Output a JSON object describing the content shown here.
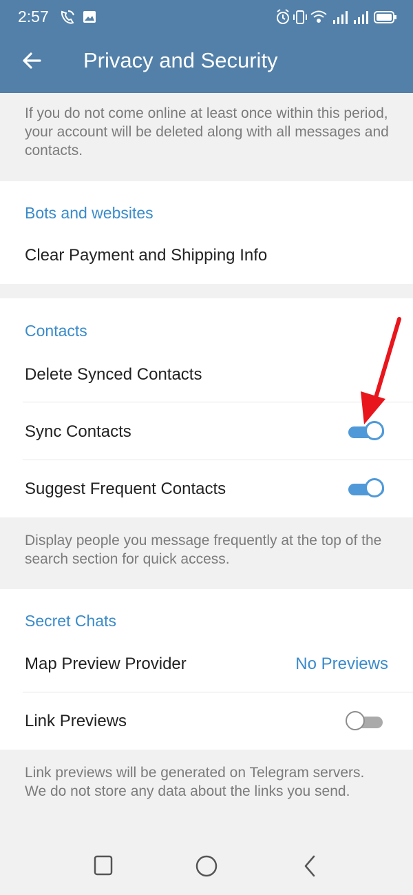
{
  "status_bar": {
    "time": "2:57",
    "left_icons": [
      "wifi-call-icon",
      "image-icon"
    ],
    "right_icons": [
      "alarm-icon",
      "vibrate-icon",
      "wifi-icon",
      "signal-icon",
      "signal-icon",
      "battery-icon"
    ]
  },
  "header": {
    "back_icon": "back-arrow-icon",
    "title": "Privacy and Security"
  },
  "account_ttl_hint": "If you do not come online at least once within this period, your account will be deleted along with all messages and contacts.",
  "bots": {
    "header": "Bots and websites",
    "clear_payment_label": "Clear Payment and Shipping Info"
  },
  "contacts": {
    "header": "Contacts",
    "delete_synced_label": "Delete Synced Contacts",
    "sync_label": "Sync Contacts",
    "sync_enabled": true,
    "suggest_label": "Suggest Frequent Contacts",
    "suggest_enabled": true,
    "hint": "Display people you message frequently at the top of the search section for quick access."
  },
  "secret_chats": {
    "header": "Secret Chats",
    "map_preview_label": "Map Preview Provider",
    "map_preview_value": "No Previews",
    "link_previews_label": "Link Previews",
    "link_previews_enabled": false,
    "hint": "Link previews will be generated on Telegram servers. We do not store any data about the links you send."
  },
  "nav_bar": {
    "icons": [
      "recent-apps-icon",
      "home-icon",
      "back-icon"
    ]
  },
  "colors": {
    "app_bar": "#5280a9",
    "accent": "#3a8bcb",
    "annotation_arrow": "#e8161c"
  }
}
